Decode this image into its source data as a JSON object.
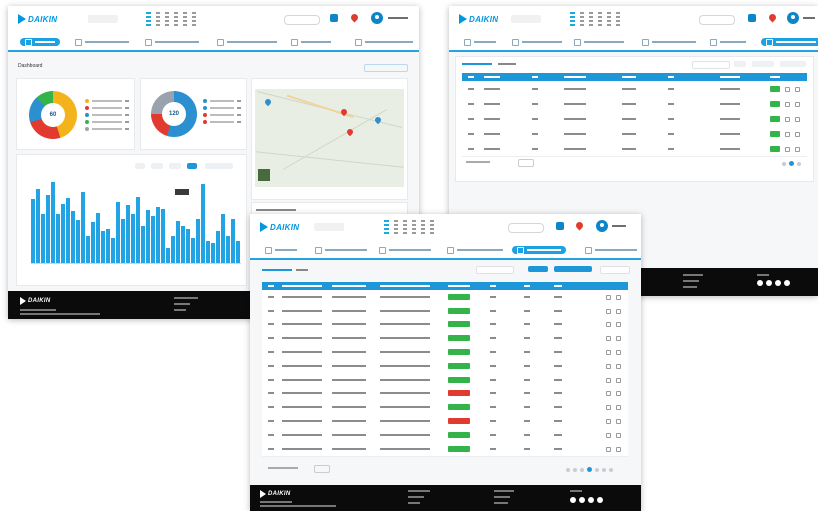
{
  "brand": {
    "logo_text": "DAIKIN",
    "accent": "#1aa2e2",
    "header_blue": "#1e97d8",
    "ok_green": "#34b34a",
    "alert_red": "#e23a2e"
  },
  "icons": [
    "logo-icon",
    "grid-icon",
    "search-icon",
    "pin-icon",
    "user-icon",
    "tab-icon",
    "social-icon"
  ],
  "dashboard": {
    "title": "Dashboard",
    "unit_status_total": "60",
    "system_overview_total": "120",
    "unit_status_segments": [
      {
        "color": "#f2b31b",
        "share": 0.45
      },
      {
        "color": "#e23a2e",
        "share": 0.25
      },
      {
        "color": "#2c8fcf",
        "share": 0.18
      },
      {
        "color": "#34b34a",
        "share": 0.12
      }
    ],
    "system_segments": [
      {
        "color": "#2c8fcf",
        "share": 0.55
      },
      {
        "color": "#e23a2e",
        "share": 0.2
      },
      {
        "color": "#9aa3ad",
        "share": 0.25
      }
    ],
    "energy_bars": [
      52,
      60,
      40,
      55,
      66,
      40,
      48,
      53,
      42,
      35,
      58,
      22,
      33,
      41,
      26,
      28,
      20,
      50,
      36,
      47,
      40,
      54,
      30,
      43,
      38,
      46,
      44,
      12,
      22,
      34,
      30,
      28,
      20,
      36,
      64,
      18,
      16,
      26,
      40,
      22,
      36,
      18
    ]
  },
  "table_view": {
    "rows_small": 5,
    "rows_large": 12,
    "status_pattern": [
      "ok",
      "ok",
      "ok",
      "ok",
      "ok",
      "ok",
      "ok",
      "alert",
      "ok",
      "alert",
      "ok",
      "ok"
    ]
  }
}
